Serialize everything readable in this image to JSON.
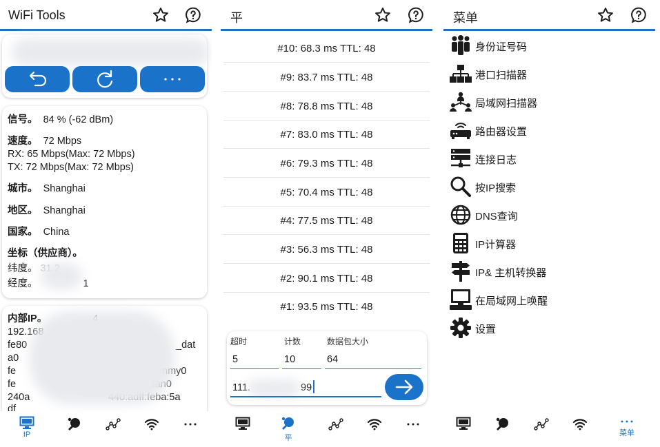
{
  "left": {
    "title": "WiFi Tools",
    "info": {
      "signal_label": "信号。",
      "signal_value": "84 % (-62 dBm)",
      "speed_label": "速度。",
      "speed_value": "72 Mbps",
      "rx": "RX: 65 Mbps(Max: 72 Mbps)",
      "tx": "TX: 72 Mbps(Max: 72 Mbps)",
      "city_label": "城市。",
      "city_value": "Shanghai",
      "region_label": "地区。",
      "region_value": "Shanghai",
      "country_label": "国家。",
      "country_value": "China",
      "coord_label": "坐标（供应商）。",
      "lat_label": "纬度。",
      "lat_partial": "31.2",
      "lon_label": "经度。",
      "lon_partial": "1"
    },
    "internal": {
      "label": "内部IP。",
      "partial_tail": "4",
      "line1": "192.168",
      "line2a": "fe80",
      "line2b": "%",
      "line2c": "_dat",
      "line3": "a0",
      "line4a": "fe",
      "line4b": "mmy0",
      "line5a": "fe",
      "line5b": "wlan0",
      "line6a": "240a",
      "line6b": "440:adff:feba:5a",
      "line7": "df"
    },
    "nav_ip_label": "IP"
  },
  "middle": {
    "title": "平",
    "pings": [
      "#10: 68.3 ms TTL: 48",
      "#9: 83.7 ms TTL: 48",
      "#8: 78.8 ms TTL: 48",
      "#7: 83.0 ms TTL: 48",
      "#6: 79.3 ms TTL: 48",
      "#5: 70.4 ms TTL: 48",
      "#4: 77.5 ms TTL: 48",
      "#3: 56.3 ms TTL: 48",
      "#2: 90.1 ms TTL: 48",
      "#1: 93.5 ms TTL: 48"
    ],
    "form": {
      "timeout_label": "超时",
      "timeout_value": "5",
      "count_label": "计数",
      "count_value": "10",
      "size_label": "数据包大小",
      "size_value": "64",
      "host_prefix": "111.",
      "host_suffix": "99"
    },
    "nav_ping_label": "平"
  },
  "right": {
    "title": "菜单",
    "items": [
      {
        "label": "身份证号码",
        "icon": "people-icon"
      },
      {
        "label": "港口扫描器",
        "icon": "network-icon"
      },
      {
        "label": "局域网扫描器",
        "icon": "lan-icon"
      },
      {
        "label": "路由器设置",
        "icon": "router-icon"
      },
      {
        "label": "连接日志",
        "icon": "server-icon"
      },
      {
        "label": "按IP搜索",
        "icon": "search-icon"
      },
      {
        "label": "DNS查询",
        "icon": "globe-icon"
      },
      {
        "label": "IP计算器",
        "icon": "calculator-icon"
      },
      {
        "label": "IP& 主机转换器",
        "icon": "signpost-icon"
      },
      {
        "label": "在局域网上唤醒",
        "icon": "computer-icon"
      },
      {
        "label": "设置",
        "icon": "gear-icon"
      }
    ],
    "nav_menu_label": "菜单"
  },
  "colors": {
    "accent": "#1a73c8",
    "text": "#1b1b1b",
    "divider": "#e6e6e6"
  }
}
